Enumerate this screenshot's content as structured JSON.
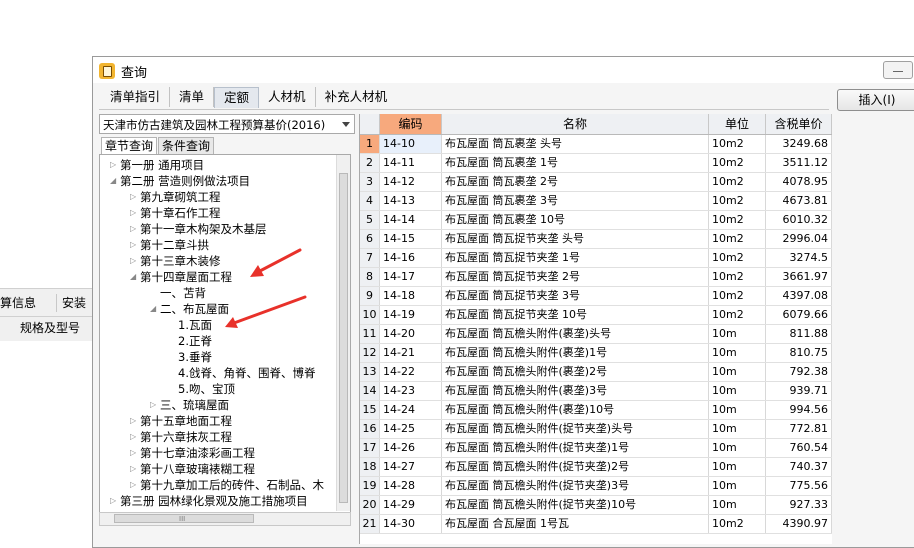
{
  "background": {
    "tab1": "算信息",
    "tab2": "安装",
    "column": "规格及型号"
  },
  "window": {
    "title": "查询",
    "tabs": [
      "清单指引",
      "清单",
      "定额",
      "人材机",
      "补充人材机"
    ],
    "active_tab": "定额",
    "insert_button": "插入(I)"
  },
  "left_panel": {
    "combo_value": "天津市仿古建筑及园林工程预算基价(2016)",
    "tabs": [
      "章节查询",
      "条件查询"
    ],
    "tree": [
      {
        "label": "第一册 通用项目",
        "level": 0,
        "toggle": "▷"
      },
      {
        "label": "第二册 营造则例做法项目",
        "level": 0,
        "toggle": "◢"
      },
      {
        "label": "第九章砌筑工程",
        "level": 1,
        "toggle": "▷"
      },
      {
        "label": "第十章石作工程",
        "level": 1,
        "toggle": "▷"
      },
      {
        "label": "第十一章木构架及木基层",
        "level": 1,
        "toggle": "▷"
      },
      {
        "label": "第十二章斗拱",
        "level": 1,
        "toggle": "▷"
      },
      {
        "label": "第十三章木装修",
        "level": 1,
        "toggle": "▷"
      },
      {
        "label": "第十四章屋面工程",
        "level": 1,
        "toggle": "◢"
      },
      {
        "label": "一、苫背",
        "level": 2,
        "toggle": ""
      },
      {
        "label": "二、布瓦屋面",
        "level": 2,
        "toggle": "◢"
      },
      {
        "label": "1.瓦面",
        "level": 3,
        "toggle": ""
      },
      {
        "label": "2.正脊",
        "level": 3,
        "toggle": ""
      },
      {
        "label": "3.垂脊",
        "level": 3,
        "toggle": ""
      },
      {
        "label": "4.戗脊、角脊、围脊、博脊",
        "level": 3,
        "toggle": ""
      },
      {
        "label": "5.吻、宝顶",
        "level": 3,
        "toggle": ""
      },
      {
        "label": "三、琉璃屋面",
        "level": 2,
        "toggle": "▷"
      },
      {
        "label": "第十五章地面工程",
        "level": 1,
        "toggle": "▷"
      },
      {
        "label": "第十六章抹灰工程",
        "level": 1,
        "toggle": "▷"
      },
      {
        "label": "第十七章油漆彩画工程",
        "level": 1,
        "toggle": "▷"
      },
      {
        "label": "第十八章玻璃裱糊工程",
        "level": 1,
        "toggle": "▷"
      },
      {
        "label": "第十九章加工后的砖件、石制品、木",
        "level": 1,
        "toggle": "▷"
      },
      {
        "label": "第三册 园林绿化景观及施工措施项目",
        "level": 0,
        "toggle": "▷"
      }
    ],
    "hscroll_grip": "III"
  },
  "table": {
    "columns": [
      "",
      "编码",
      "名称",
      "单位",
      "含税单价"
    ],
    "rows": [
      [
        "1",
        "14-10",
        "布瓦屋面 筒瓦裹垄 头号",
        "10m2",
        "3249.68"
      ],
      [
        "2",
        "14-11",
        "布瓦屋面 筒瓦裹垄 1号",
        "10m2",
        "3511.12"
      ],
      [
        "3",
        "14-12",
        "布瓦屋面 筒瓦裹垄 2号",
        "10m2",
        "4078.95"
      ],
      [
        "4",
        "14-13",
        "布瓦屋面 筒瓦裹垄 3号",
        "10m2",
        "4673.81"
      ],
      [
        "5",
        "14-14",
        "布瓦屋面 筒瓦裹垄 10号",
        "10m2",
        "6010.32"
      ],
      [
        "6",
        "14-15",
        "布瓦屋面 筒瓦捉节夹垄 头号",
        "10m2",
        "2996.04"
      ],
      [
        "7",
        "14-16",
        "布瓦屋面 筒瓦捉节夹垄 1号",
        "10m2",
        "3274.5"
      ],
      [
        "8",
        "14-17",
        "布瓦屋面 筒瓦捉节夹垄 2号",
        "10m2",
        "3661.97"
      ],
      [
        "9",
        "14-18",
        "布瓦屋面 筒瓦捉节夹垄 3号",
        "10m2",
        "4397.08"
      ],
      [
        "10",
        "14-19",
        "布瓦屋面 筒瓦捉节夹垄 10号",
        "10m2",
        "6079.66"
      ],
      [
        "11",
        "14-20",
        "布瓦屋面 筒瓦檐头附件(裹垄)头号",
        "10m",
        "811.88"
      ],
      [
        "12",
        "14-21",
        "布瓦屋面 筒瓦檐头附件(裹垄)1号",
        "10m",
        "810.75"
      ],
      [
        "13",
        "14-22",
        "布瓦屋面 筒瓦檐头附件(裹垄)2号",
        "10m",
        "792.38"
      ],
      [
        "14",
        "14-23",
        "布瓦屋面 筒瓦檐头附件(裹垄)3号",
        "10m",
        "939.71"
      ],
      [
        "15",
        "14-24",
        "布瓦屋面 筒瓦檐头附件(裹垄)10号",
        "10m",
        "994.56"
      ],
      [
        "16",
        "14-25",
        "布瓦屋面 筒瓦檐头附件(捉节夹垄)头号",
        "10m",
        "772.81"
      ],
      [
        "17",
        "14-26",
        "布瓦屋面 筒瓦檐头附件(捉节夹垄)1号",
        "10m",
        "760.54"
      ],
      [
        "18",
        "14-27",
        "布瓦屋面 筒瓦檐头附件(捉节夹垄)2号",
        "10m",
        "740.37"
      ],
      [
        "19",
        "14-28",
        "布瓦屋面 筒瓦檐头附件(捉节夹垄)3号",
        "10m",
        "775.56"
      ],
      [
        "20",
        "14-29",
        "布瓦屋面 筒瓦檐头附件(捉节夹垄)10号",
        "10m",
        "927.33"
      ],
      [
        "21",
        "14-30",
        "布瓦屋面 合瓦屋面 1号瓦",
        "10m2",
        "4390.97"
      ]
    ]
  },
  "colors": {
    "selected_header": "#f7a97d",
    "arrow": "#e8312a",
    "icon": "#f2b530"
  }
}
